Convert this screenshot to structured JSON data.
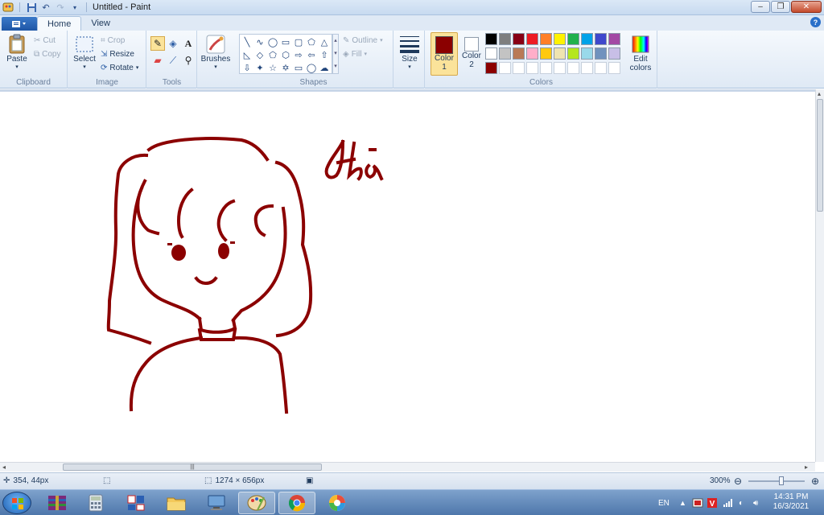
{
  "window": {
    "title": "Untitled - Paint"
  },
  "tabs": [
    {
      "label": "Home"
    },
    {
      "label": "View"
    }
  ],
  "clipboard": {
    "paste": "Paste",
    "cut": "Cut",
    "copy": "Copy",
    "label": "Clipboard"
  },
  "image": {
    "select": "Select",
    "crop": "Crop",
    "resize": "Resize",
    "rotate": "Rotate",
    "label": "Image"
  },
  "tools": {
    "label": "Tools",
    "brushes": "Brushes"
  },
  "shapes": {
    "outline": "Outline",
    "fill": "Fill",
    "label": "Shapes"
  },
  "size": {
    "label": "Size"
  },
  "colors": {
    "color1_label": "Color",
    "color1_num": "1",
    "color2_label": "Color",
    "color2_num": "2",
    "edit_colors": "Edit",
    "edit_colors2": "colors",
    "label": "Colors",
    "color1": "#8b0000",
    "color2": "#ffffff",
    "palette_row1": [
      "#000000",
      "#7f7f7f",
      "#880015",
      "#ed1c24",
      "#ff7f27",
      "#fff200",
      "#22b14c",
      "#00a2e8",
      "#3f48cc",
      "#a349a4"
    ],
    "palette_row2": [
      "#ffffff",
      "#c3c3c3",
      "#b97a57",
      "#ffaec9",
      "#ffc90e",
      "#efe4b0",
      "#b5e61d",
      "#99d9ea",
      "#7092be",
      "#c8bfe7"
    ],
    "custom_first": "#8b0000"
  },
  "status": {
    "cursor_pos": "354, 44px",
    "canvas_size": "1274 × 656px",
    "zoom": "300%"
  },
  "taskbar": {
    "lang": "EN",
    "time": "14:31 PM",
    "date": "16/3/2021"
  },
  "drawing": {
    "stroke": "#8b0000"
  }
}
